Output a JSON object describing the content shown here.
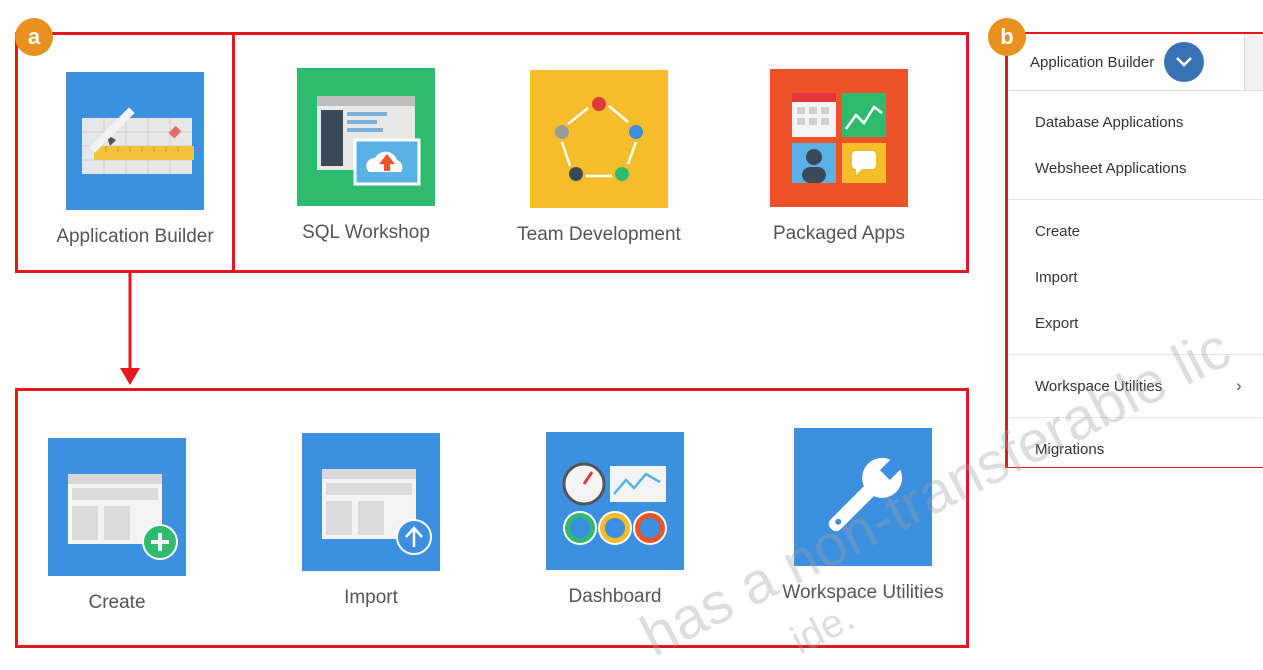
{
  "badges": {
    "a": "a",
    "b": "b"
  },
  "top_tiles": [
    {
      "label": "Application Builder"
    },
    {
      "label": "SQL Workshop"
    },
    {
      "label": "Team Development"
    },
    {
      "label": "Packaged Apps"
    }
  ],
  "bottom_tiles": [
    {
      "label": "Create"
    },
    {
      "label": "Import"
    },
    {
      "label": "Dashboard"
    },
    {
      "label": "Workspace Utilities"
    }
  ],
  "menu": {
    "header": "Application Builder",
    "groups": [
      [
        "Database Applications",
        "Websheet Applications"
      ],
      [
        "Create",
        "Import",
        "Export"
      ],
      [
        "Workspace Utilities"
      ],
      [
        "Migrations"
      ]
    ]
  },
  "watermark": "has a non-transferable lic",
  "watermark2": "ide."
}
